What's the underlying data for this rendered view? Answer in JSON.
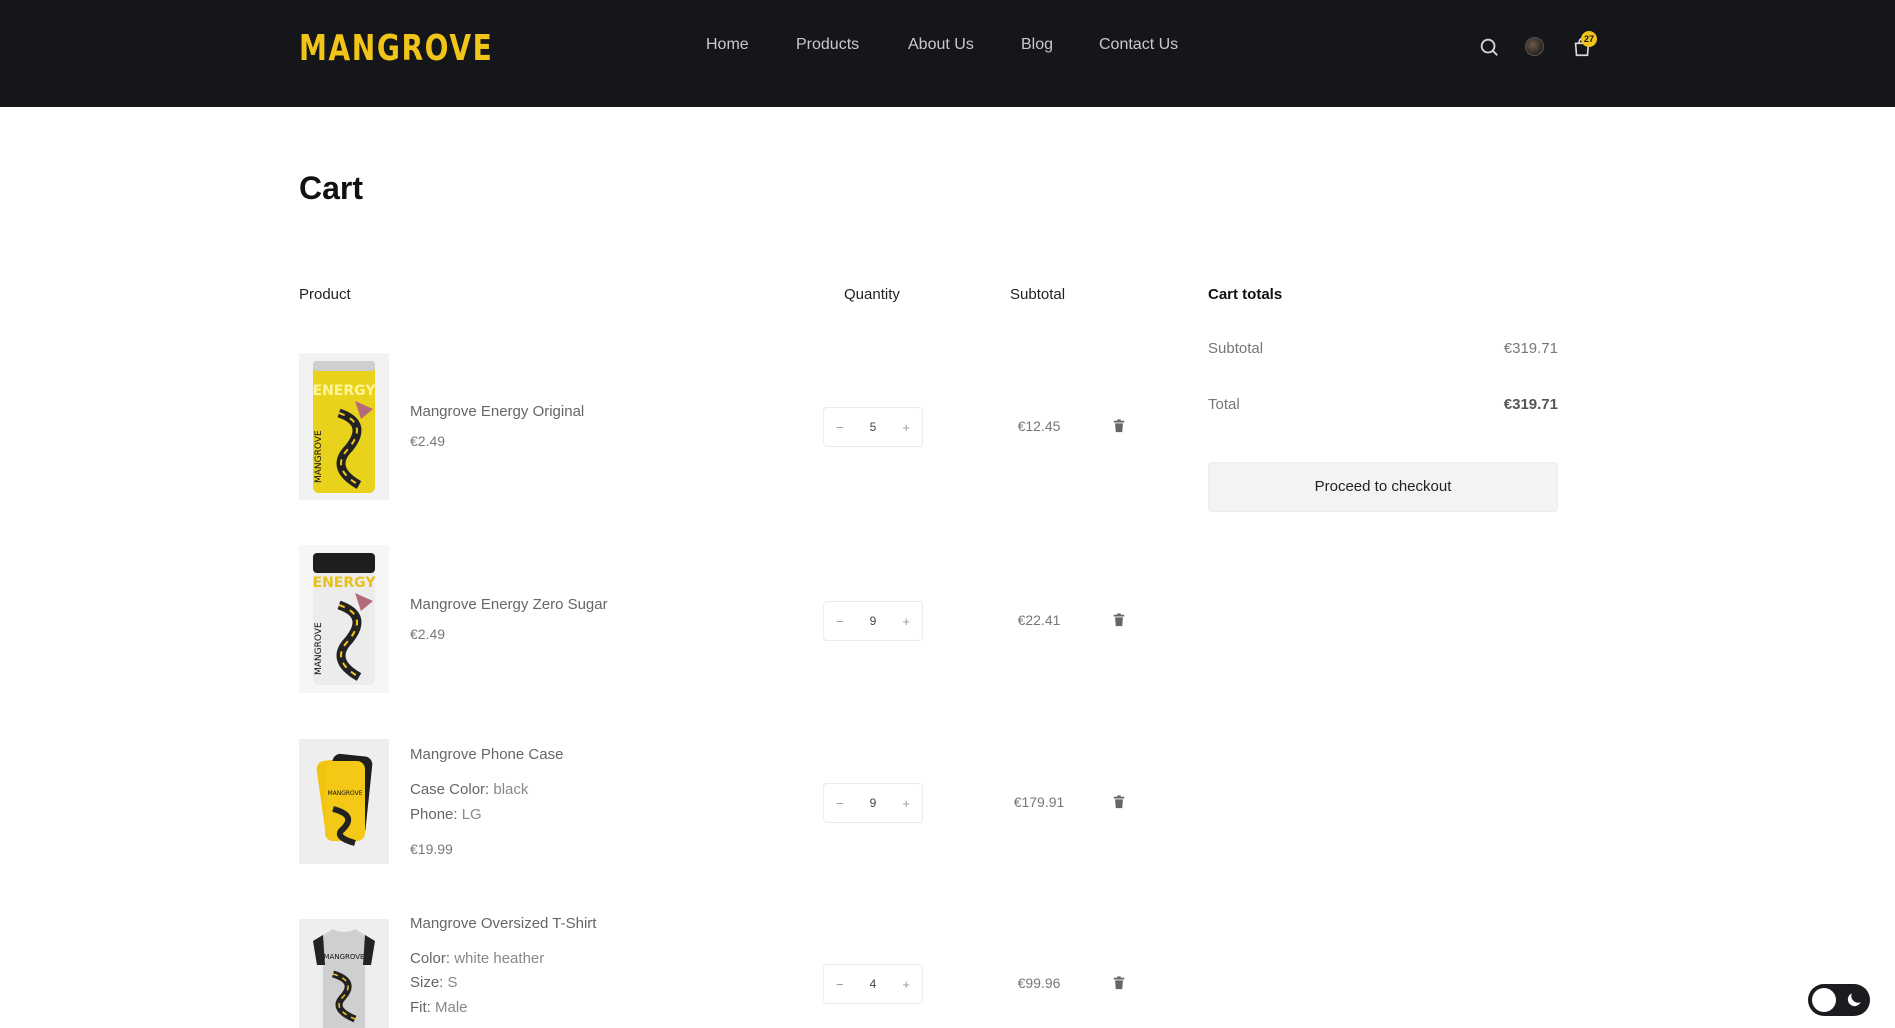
{
  "header": {
    "logo": "MANGROVE",
    "nav": [
      "Home",
      "Products",
      "About Us",
      "Blog",
      "Contact Us"
    ],
    "cart_count": "27",
    "icons": [
      "search-icon",
      "avatar",
      "shopping-bag-icon"
    ],
    "accent_color": "#f0c419",
    "background_color": "#141619"
  },
  "page": {
    "title": "Cart"
  },
  "table": {
    "headers": {
      "product": "Product",
      "quantity": "Quantity",
      "subtotal": "Subtotal"
    },
    "items": [
      {
        "name": "Mangrove Energy Original",
        "price": "€2.49",
        "qty": "5",
        "subtotal": "€12.45",
        "attrs": []
      },
      {
        "name": "Mangrove Energy Zero Sugar",
        "price": "€2.49",
        "qty": "9",
        "subtotal": "€22.41",
        "attrs": []
      },
      {
        "name": "Mangrove Phone Case",
        "price": "€19.99",
        "qty": "9",
        "subtotal": "€179.91",
        "attrs": [
          {
            "label": "Case Color:",
            "value": "black"
          },
          {
            "label": "Phone:",
            "value": "LG"
          }
        ]
      },
      {
        "name": "Mangrove Oversized T-Shirt",
        "price": "",
        "qty": "4",
        "subtotal": "€99.96",
        "attrs": [
          {
            "label": "Color:",
            "value": "white heather"
          },
          {
            "label": "Size:",
            "value": "S"
          },
          {
            "label": "Fit:",
            "value": "Male"
          }
        ]
      }
    ],
    "qty_decrease": "−",
    "qty_increase": "+"
  },
  "totals": {
    "title": "Cart totals",
    "subtotal_label": "Subtotal",
    "subtotal_value": "€319.71",
    "total_label": "Total",
    "total_value": "€319.71",
    "checkout_label": "Proceed to checkout"
  },
  "theme_toggle": {
    "icon": "moon-icon",
    "state": "light"
  }
}
